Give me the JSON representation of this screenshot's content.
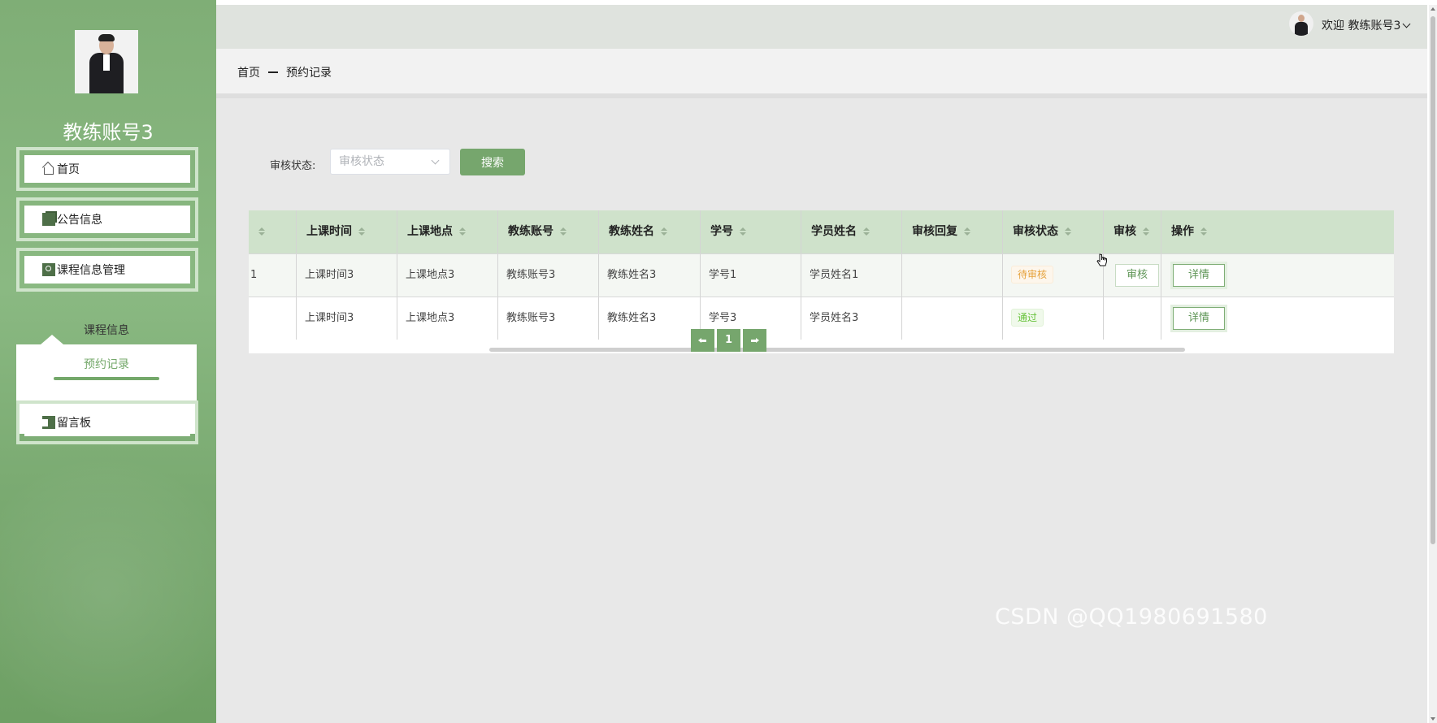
{
  "sidebar": {
    "username": "教练账号3",
    "menu": [
      {
        "label": "首页",
        "icon": "home-icon"
      },
      {
        "label": "公告信息",
        "icon": "notice-icon"
      },
      {
        "label": "课程信息管理",
        "icon": "course-icon"
      },
      {
        "label": "留言板",
        "icon": "message-board-icon"
      }
    ],
    "submenu": [
      {
        "label": "课程信息",
        "active": false
      },
      {
        "label": "预约记录",
        "active": true
      }
    ]
  },
  "topbar": {
    "welcome": "欢迎 教练账号3"
  },
  "breadcrumb": {
    "home": "首页",
    "current": "预约记录"
  },
  "filter": {
    "label": "审核状态:",
    "placeholder": "审核状态",
    "search_label": "搜索"
  },
  "table": {
    "columns": [
      "",
      "上课时间",
      "上课地点",
      "教练账号",
      "教练姓名",
      "学号",
      "学员姓名",
      "审核回复",
      "审核状态",
      "审核",
      "操作"
    ],
    "rows": [
      {
        "idx": "1",
        "time": "上课时间3",
        "place": "上课地点3",
        "coach_account": "教练账号3",
        "coach_name": "教练姓名3",
        "student_id": "学号1",
        "student_name": "学员姓名1",
        "reply": "",
        "status": "待审核",
        "status_type": "pending",
        "audit_btn": "审核",
        "detail_btn": "详情"
      },
      {
        "idx": "",
        "time": "上课时间3",
        "place": "上课地点3",
        "coach_account": "教练账号3",
        "coach_name": "教练姓名3",
        "student_id": "学号3",
        "student_name": "学员姓名3",
        "reply": "",
        "status": "通过",
        "status_type": "pass",
        "audit_btn": "",
        "detail_btn": "详情"
      }
    ]
  },
  "pagination": {
    "current_page": "1"
  },
  "watermark": "CSDN @QQ1980691580",
  "colors": {
    "accent": "#76a66d",
    "header_bg": "#cfe2cb",
    "pending": "#e6a23c",
    "pass": "#67c23a"
  }
}
